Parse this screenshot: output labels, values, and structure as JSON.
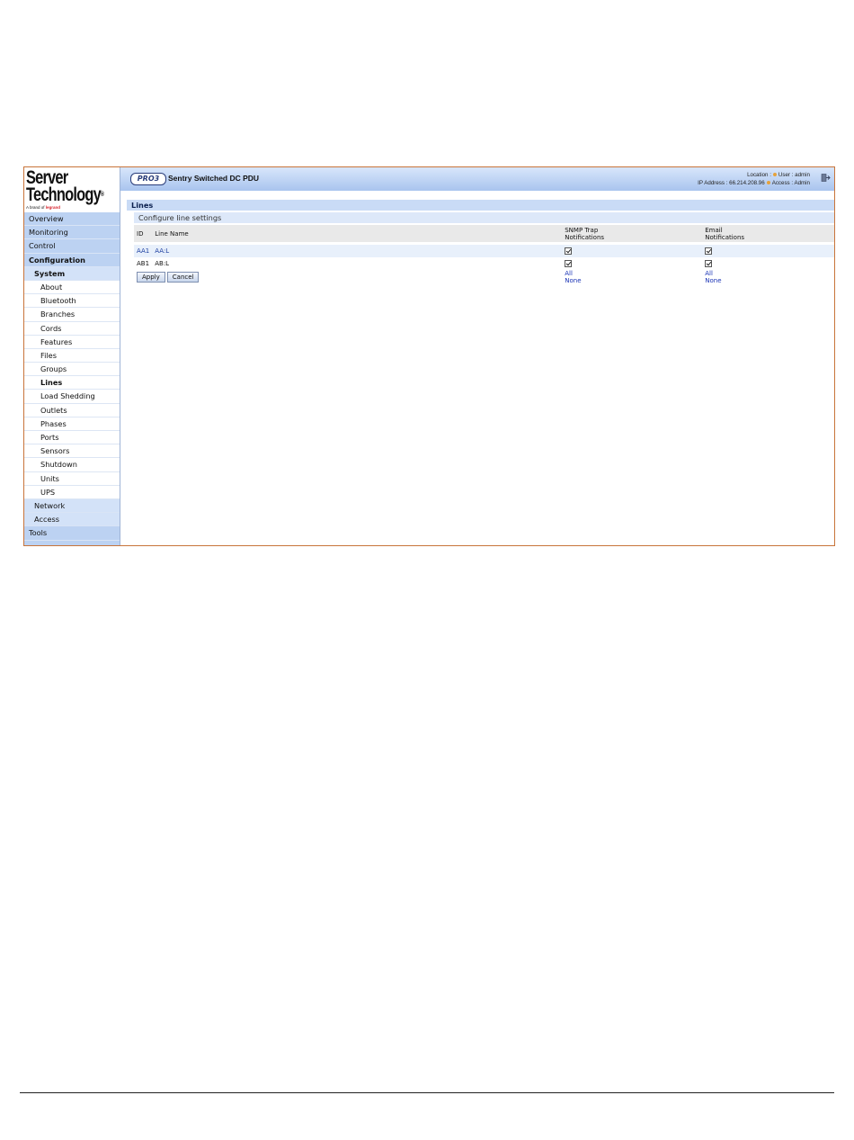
{
  "logo": {
    "line1": "Server",
    "line2": "Technology",
    "reg": "®",
    "brand_prefix": "A brand of",
    "brand_name": "legrand"
  },
  "nav": {
    "items": [
      {
        "label": "Overview",
        "level": 0
      },
      {
        "label": "Monitoring",
        "level": 0
      },
      {
        "label": "Control",
        "level": 0
      },
      {
        "label": "Configuration",
        "level": 0,
        "bold": true
      },
      {
        "label": "System",
        "level": 1,
        "bold": true
      },
      {
        "label": "About",
        "level": 2
      },
      {
        "label": "Bluetooth",
        "level": 2
      },
      {
        "label": "Branches",
        "level": 2
      },
      {
        "label": "Cords",
        "level": 2
      },
      {
        "label": "Features",
        "level": 2
      },
      {
        "label": "Files",
        "level": 2
      },
      {
        "label": "Groups",
        "level": 2
      },
      {
        "label": "Lines",
        "level": 2,
        "active": true
      },
      {
        "label": "Load Shedding",
        "level": 2
      },
      {
        "label": "Outlets",
        "level": 2
      },
      {
        "label": "Phases",
        "level": 2
      },
      {
        "label": "Ports",
        "level": 2
      },
      {
        "label": "Sensors",
        "level": 2
      },
      {
        "label": "Shutdown",
        "level": 2
      },
      {
        "label": "Units",
        "level": 2
      },
      {
        "label": "UPS",
        "level": 2
      },
      {
        "label": "Network",
        "level": 1
      },
      {
        "label": "Access",
        "level": 1
      },
      {
        "label": "Tools",
        "level": 0
      }
    ]
  },
  "header": {
    "badge": "PRO3",
    "product": "Sentry Switched DC PDU",
    "location_label": "Location :",
    "user_label": "User : admin",
    "ip_label": "IP Address : 66.214.208.96",
    "access_label": "Access : Admin"
  },
  "page": {
    "title": "Lines",
    "subtitle": "Configure line settings"
  },
  "table": {
    "headers": {
      "id": "ID",
      "name": "Line Name",
      "snmp_1": "SNMP Trap",
      "snmp_2": "Notifications",
      "email_1": "Email",
      "email_2": "Notifications"
    },
    "rows": [
      {
        "id": "AA1",
        "name": "AA:L",
        "snmp": true,
        "email": true
      },
      {
        "id": "AB1",
        "name": "AB:L",
        "snmp": true,
        "email": true
      }
    ]
  },
  "actions": {
    "apply": "Apply",
    "cancel": "Cancel",
    "snmp_all": "All",
    "snmp_none": "None",
    "email_all": "All",
    "email_none": "None"
  },
  "colors": {
    "frame_border": "#c8743a",
    "nav_bg": "#bcd2f2",
    "header_bg": "#a9c4ee",
    "link": "#1a33b5"
  }
}
